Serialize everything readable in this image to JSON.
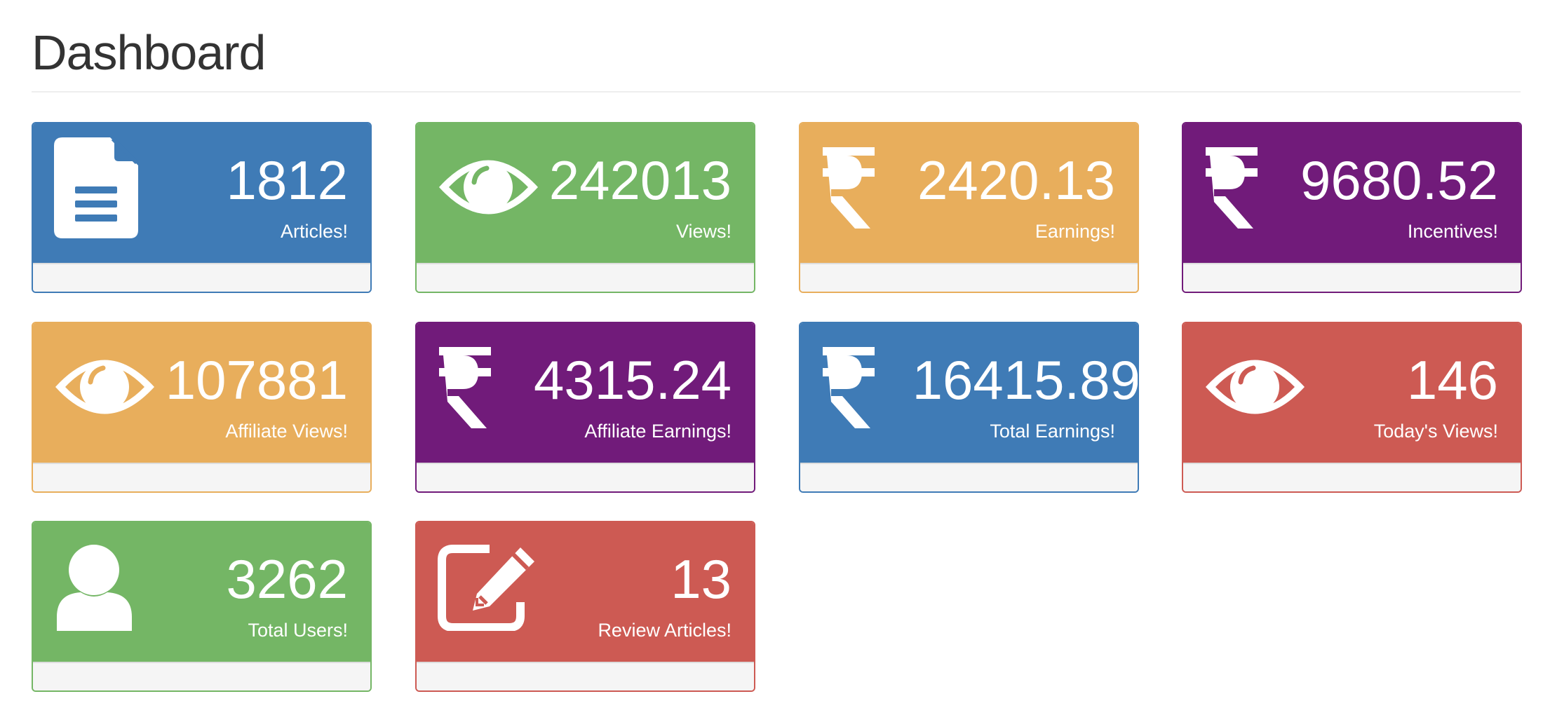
{
  "page": {
    "title": "Dashboard"
  },
  "colors": {
    "blue": "#337ab7",
    "green": "#5cb85c",
    "orange": "#f0ad4e",
    "purple": "#6f1f7a",
    "red": "#d9534f",
    "footer": "#f5f5f5"
  },
  "panels": [
    {
      "value": "1812",
      "label": "Articles!",
      "icon": "file-text-icon",
      "color": "#3f7bb6"
    },
    {
      "value": "242013",
      "label": "Views!",
      "icon": "eye-icon",
      "color": "#74b665"
    },
    {
      "value": "2420.13",
      "label": "Earnings!",
      "icon": "rupee-icon",
      "color": "#e8ae5c"
    },
    {
      "value": "9680.52",
      "label": "Incentives!",
      "icon": "rupee-icon",
      "color": "#711b7a"
    },
    {
      "value": "107881",
      "label": "Affiliate Views!",
      "icon": "eye-icon",
      "color": "#e8ae5c"
    },
    {
      "value": "4315.24",
      "label": "Affiliate Earnings!",
      "icon": "rupee-icon",
      "color": "#711b7a"
    },
    {
      "value": "16415.89",
      "label": "Total Earnings!",
      "icon": "rupee-icon",
      "color": "#3f7bb6"
    },
    {
      "value": "146",
      "label": "Today's Views!",
      "icon": "eye-icon",
      "color": "#cd5a53"
    },
    {
      "value": "3262",
      "label": "Total Users!",
      "icon": "user-icon",
      "color": "#74b665"
    },
    {
      "value": "13",
      "label": "Review Articles!",
      "icon": "edit-icon",
      "color": "#cd5a53"
    }
  ]
}
